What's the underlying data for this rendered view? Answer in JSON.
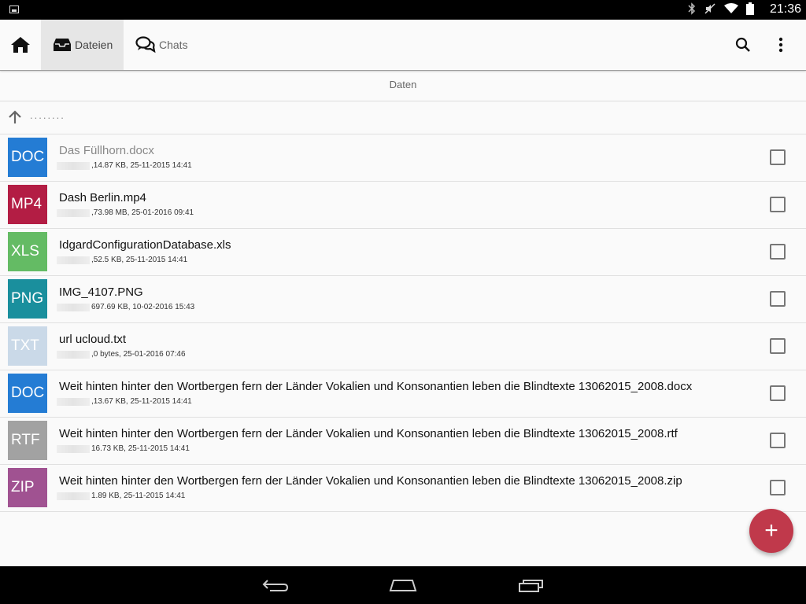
{
  "status_bar": {
    "time": "21:36",
    "icons": [
      "image-icon",
      "bluetooth-icon",
      "mute-icon",
      "wifi-icon",
      "battery-icon"
    ]
  },
  "toolbar": {
    "tabs": [
      {
        "label": "Dateien",
        "icon": "inbox-icon",
        "active": true
      },
      {
        "label": "Chats",
        "icon": "chat-icon",
        "active": false
      }
    ],
    "actions": [
      "search-icon",
      "more-vert-icon"
    ]
  },
  "section_header": "Daten",
  "parent_row": {
    "dots": "........"
  },
  "files": [
    {
      "ext": "DOC",
      "color": "#1976d2",
      "name": "Das Füllhorn.docx",
      "meta": ",14.87 KB, 25-11-2015 14:41",
      "dim": true
    },
    {
      "ext": "MP4",
      "color": "#b0123b",
      "name": "Dash Berlin.mp4",
      "meta": ",73.98 MB, 25-01-2016 09:41",
      "dim": false
    },
    {
      "ext": "XLS",
      "color": "#5cb85c",
      "name": "IdgardConfigurationDatabase.xls",
      "meta": ",52.5 KB, 25-11-2015 14:41",
      "dim": false
    },
    {
      "ext": "PNG",
      "color": "#0f8a99",
      "name": "IMG_4107.PNG",
      "meta": "697.69 KB, 10-02-2016 15:43",
      "dim": false
    },
    {
      "ext": "TXT",
      "color": "#c8d8e8",
      "name": "url ucloud.txt",
      "meta": ",0 bytes, 25-01-2016 07:46",
      "dim": false
    },
    {
      "ext": "DOC",
      "color": "#1976d2",
      "name": "Weit hinten hinter den Wortbergen  fern der Länder Vokalien und Konsonantien leben die Blindtexte 13062015_2008.docx",
      "meta": ",13.67 KB, 25-11-2015 14:41",
      "dim": false
    },
    {
      "ext": "RTF",
      "color": "#9e9e9e",
      "name": "Weit hinten hinter den Wortbergen  fern der Länder Vokalien und Konsonantien leben die Blindtexte 13062015_2008.rtf",
      "meta": "16.73 KB, 25-11-2015 14:41",
      "dim": false
    },
    {
      "ext": "ZIP",
      "color": "#9c4a8c",
      "name": "Weit hinten hinter den Wortbergen  fern der Länder Vokalien und Konsonantien leben die Blindtexte 13062015_2008.zip",
      "meta": "1.89 KB, 25-11-2015 14:41",
      "dim": false
    }
  ],
  "fab": {
    "label": "+",
    "color": "#c0394b"
  },
  "nav_bar": {
    "buttons": [
      "back-icon",
      "home-icon",
      "recents-icon"
    ]
  }
}
